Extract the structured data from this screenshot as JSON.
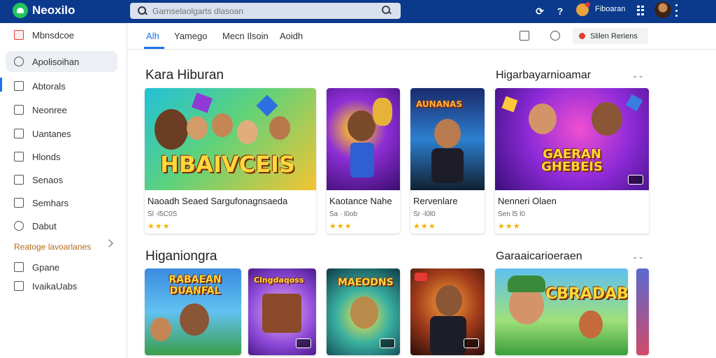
{
  "app": {
    "name": "Neoxilo",
    "search_placeholder": "Garnselaolgarts dlasoan",
    "user_label": "Fiboaran"
  },
  "colors": {
    "topbar": "#0b3a8c",
    "accent": "#1a73e8",
    "star": "#f5b301"
  },
  "sidebar": {
    "items": [
      {
        "label": "Mbnsdcoe",
        "icon": "store-icon"
      },
      {
        "label": "Apolisoihan",
        "icon": "user-icon"
      },
      {
        "label": "Abtorals",
        "icon": "document-icon"
      },
      {
        "label": "Neonree",
        "icon": "list-icon"
      },
      {
        "label": "Uantanes",
        "icon": "calendar-icon"
      },
      {
        "label": "Hlonds",
        "icon": "book-icon"
      },
      {
        "label": "Senaos",
        "icon": "tag-icon"
      },
      {
        "label": "Semhars",
        "icon": "news-icon"
      },
      {
        "label": "Dabut",
        "icon": "profile-icon"
      }
    ],
    "section_label": "Reatoge lavoarlanes",
    "sub_items": [
      {
        "label": "Gpane",
        "icon": "grid-icon"
      },
      {
        "label": "IvaikaUabs",
        "icon": "library-icon"
      }
    ]
  },
  "tabs": [
    {
      "label": "Alh"
    },
    {
      "label": "Yamego"
    },
    {
      "label": "Mecn Ilsoin"
    },
    {
      "label": "Aoidh"
    }
  ],
  "toolbar": {
    "pill_label": "Slilen Reriens"
  },
  "sections": [
    {
      "title": "Kara Hiburan",
      "right_title": "Higarbayarnioamar",
      "cards": [
        {
          "title": "Naoadh Seaed Sargufonagnsaeda",
          "meta": "Sl -l5C0S",
          "rating": "★★★",
          "art": "HBAIVCEIS"
        },
        {
          "title": "Kaotance Nahe",
          "meta": "Sa · l0ob",
          "rating": "★★★",
          "art": ""
        },
        {
          "title": "Rervenlare",
          "meta": "Sr -l0l0",
          "rating": "★★★",
          "art": "AUNANAS"
        },
        {
          "title": "Nenneri Olaen",
          "meta": "Sen l5 l0",
          "rating": "★★★",
          "art": "GAERAN GHEBEIS"
        }
      ]
    },
    {
      "title": "Higaniongra",
      "right_title": "Garaaicarioeraen",
      "cards": [
        {
          "art": "RABAEAN DUANFAL"
        },
        {
          "art": "Clngdaqoss"
        },
        {
          "art": "MAEODNS"
        },
        {
          "art": ""
        },
        {
          "art": "CBRADAB"
        }
      ]
    }
  ]
}
